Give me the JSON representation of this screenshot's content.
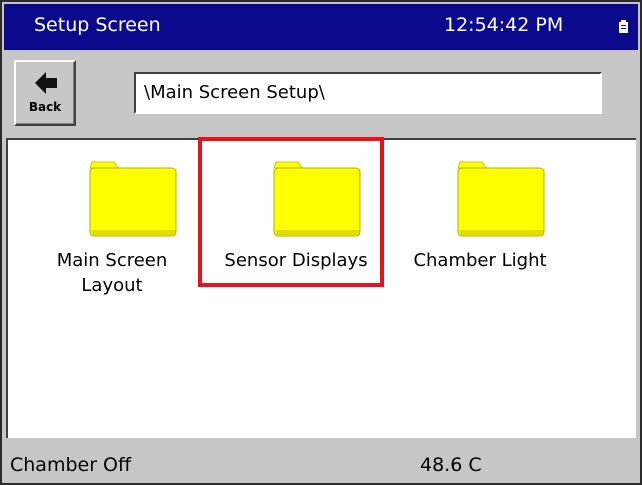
{
  "titlebar": {
    "title": "Setup Screen",
    "time": "12:54:42 PM",
    "background": "#0c0a8c"
  },
  "toolbar": {
    "back_label": "Back",
    "back_icon": "left-arrow-icon",
    "path_value": "\\Main Screen Setup\\"
  },
  "folders": [
    {
      "label": "Main Screen Layout",
      "line1": "Main Screen",
      "line2": "Layout",
      "icon": "folder-icon"
    },
    {
      "label": "Sensor Displays",
      "icon": "folder-icon",
      "highlighted": true
    },
    {
      "label": "Chamber Light",
      "icon": "folder-icon"
    }
  ],
  "statusbar": {
    "chamber_status": "Chamber Off",
    "temperature": "48.6 C"
  },
  "colors": {
    "folder_fill": "#ffff00",
    "highlight": "#e8131a",
    "chrome": "#c6c6c6"
  }
}
